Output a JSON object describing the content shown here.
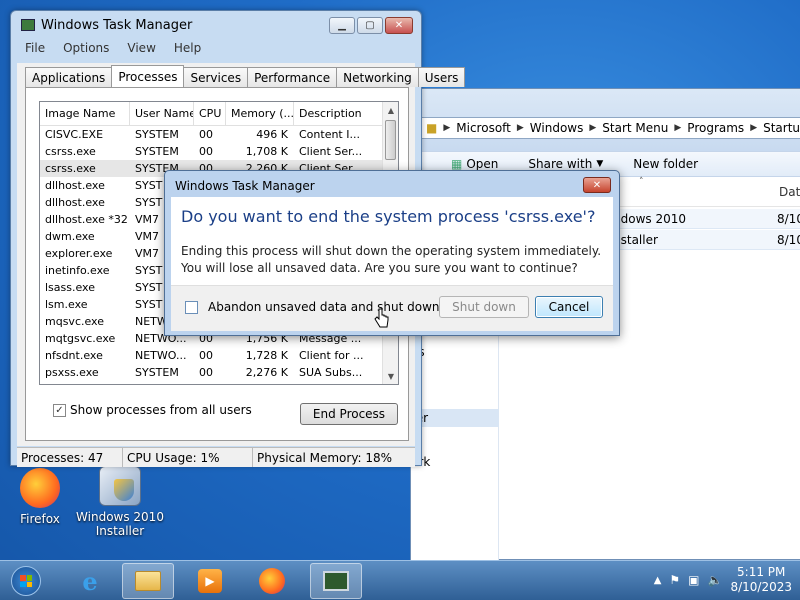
{
  "explorer": {
    "breadcrumb": [
      "Microsoft",
      "Windows",
      "Start Menu",
      "Programs",
      "Startup"
    ],
    "commands": {
      "open": "Open",
      "share_with": "Share with",
      "new_folder": "New folder"
    },
    "col_date": "Date",
    "rows": [
      {
        "name": "ndows 2010",
        "date": "8/10"
      },
      {
        "name": "nstaller",
        "date": "8/10"
      }
    ],
    "nav": {
      "es": "es",
      "s": "s",
      "ter": "ter",
      "network": "Network"
    }
  },
  "taskmgr": {
    "title": "Windows Task Manager",
    "menu": [
      "File",
      "Options",
      "View",
      "Help"
    ],
    "tabs": [
      "Applications",
      "Processes",
      "Services",
      "Performance",
      "Networking",
      "Users"
    ],
    "columns": [
      "Image Name",
      "User Name",
      "CPU",
      "Memory (...",
      "Description"
    ],
    "processes": [
      {
        "image": "CISVC.EXE",
        "user": "SYSTEM",
        "cpu": "00",
        "mem": "496 K",
        "desc": "Content I..."
      },
      {
        "image": "csrss.exe",
        "user": "SYSTEM",
        "cpu": "00",
        "mem": "1,708 K",
        "desc": "Client Ser..."
      },
      {
        "image": "csrss.exe",
        "user": "SYSTEM",
        "cpu": "00",
        "mem": "2,260 K",
        "desc": "Client Ser..."
      },
      {
        "image": "dllhost.exe",
        "user": "SYST",
        "cpu": "",
        "mem": "",
        "desc": ""
      },
      {
        "image": "dllhost.exe",
        "user": "SYST",
        "cpu": "",
        "mem": "",
        "desc": ""
      },
      {
        "image": "dllhost.exe *32",
        "user": "VM7",
        "cpu": "",
        "mem": "",
        "desc": ""
      },
      {
        "image": "dwm.exe",
        "user": "VM7",
        "cpu": "",
        "mem": "",
        "desc": ""
      },
      {
        "image": "explorer.exe",
        "user": "VM7",
        "cpu": "",
        "mem": "",
        "desc": ""
      },
      {
        "image": "inetinfo.exe",
        "user": "SYST",
        "cpu": "",
        "mem": "",
        "desc": ""
      },
      {
        "image": "lsass.exe",
        "user": "SYST",
        "cpu": "",
        "mem": "",
        "desc": ""
      },
      {
        "image": "lsm.exe",
        "user": "SYST",
        "cpu": "",
        "mem": "",
        "desc": ""
      },
      {
        "image": "mqsvc.exe",
        "user": "NETW",
        "cpu": "",
        "mem": "",
        "desc": ""
      },
      {
        "image": "mqtgsvc.exe",
        "user": "NETWO...",
        "cpu": "00",
        "mem": "1,756 K",
        "desc": "Message ..."
      },
      {
        "image": "nfsdnt.exe",
        "user": "NETWO...",
        "cpu": "00",
        "mem": "1,728 K",
        "desc": "Client for ..."
      },
      {
        "image": "psxss.exe",
        "user": "SYSTEM",
        "cpu": "00",
        "mem": "2,276 K",
        "desc": "SUA Subs..."
      }
    ],
    "show_all_label": "Show processes from all users",
    "end_process": "End Process",
    "status": {
      "processes": "Processes: 47",
      "cpu": "CPU Usage: 1%",
      "memory": "Physical Memory: 18%"
    }
  },
  "dialog": {
    "title": "Windows Task Manager",
    "question": "Do you want to end the system process 'csrss.exe'?",
    "text": "Ending this process will shut down the operating system immediately.  You will lose all unsaved data.  Are you sure you want to continue?",
    "abandon_label": "Abandon unsaved data and shut down.",
    "shutdown": "Shut down",
    "cancel": "Cancel"
  },
  "desktop": {
    "firefox": "Firefox",
    "installer_line1": "Windows 2010",
    "installer_line2": "Installer"
  },
  "taskbar": {
    "time": "5:11 PM",
    "date": "8/10/2023"
  }
}
